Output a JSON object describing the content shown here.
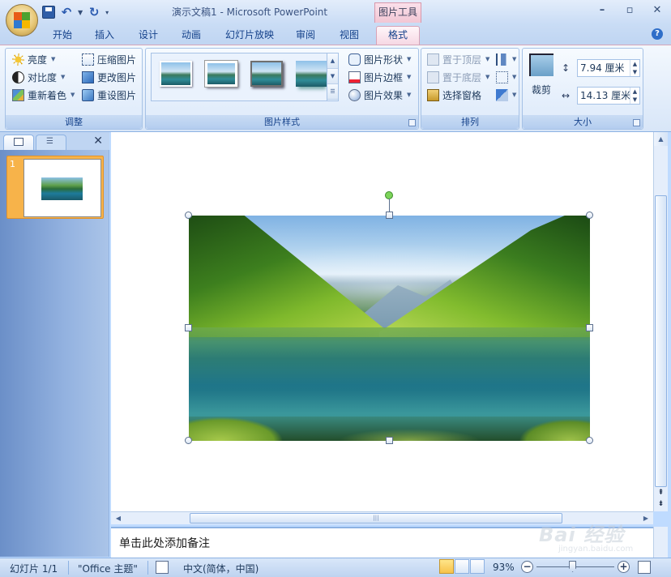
{
  "window": {
    "title": "演示文稿1 - Microsoft PowerPoint",
    "contextual_tab_group": "图片工具"
  },
  "tabs": [
    {
      "label": "开始",
      "active": false
    },
    {
      "label": "插入",
      "active": false
    },
    {
      "label": "设计",
      "active": false
    },
    {
      "label": "动画",
      "active": false
    },
    {
      "label": "幻灯片放映",
      "active": false
    },
    {
      "label": "审阅",
      "active": false
    },
    {
      "label": "视图",
      "active": false
    },
    {
      "label": "格式",
      "active": true
    }
  ],
  "ribbon": {
    "adjust": {
      "title": "调整",
      "brightness": "亮度",
      "contrast": "对比度",
      "recolor": "重新着色",
      "compress": "压缩图片",
      "change_picture": "更改图片",
      "reset_picture": "重设图片"
    },
    "picture_styles": {
      "title": "图片样式",
      "shape": "图片形状",
      "border": "图片边框",
      "effects": "图片效果"
    },
    "arrange": {
      "title": "排列",
      "bring_front": "置于顶层",
      "send_back": "置于底层",
      "selection_pane": "选择窗格"
    },
    "size": {
      "title": "大小",
      "crop": "裁剪",
      "height": "7.94 厘米",
      "width": "14.13 厘米"
    }
  },
  "slides_panel": {
    "slide_number": "1"
  },
  "notes": {
    "placeholder": "单击此处添加备注"
  },
  "status": {
    "slide": "幻灯片 1/1",
    "theme": "\"Office 主题\"",
    "language": "中文(简体，中国)",
    "zoom": "93%",
    "zoom_level": 0.47
  },
  "watermark": {
    "text": "Bai 经验",
    "sub": "jingyan.baidu.com"
  },
  "colors": {
    "accent_tab": "#f2c6d4",
    "ribbon_bg": "#dbe8f8",
    "selected_slide": "#f7b34a"
  }
}
